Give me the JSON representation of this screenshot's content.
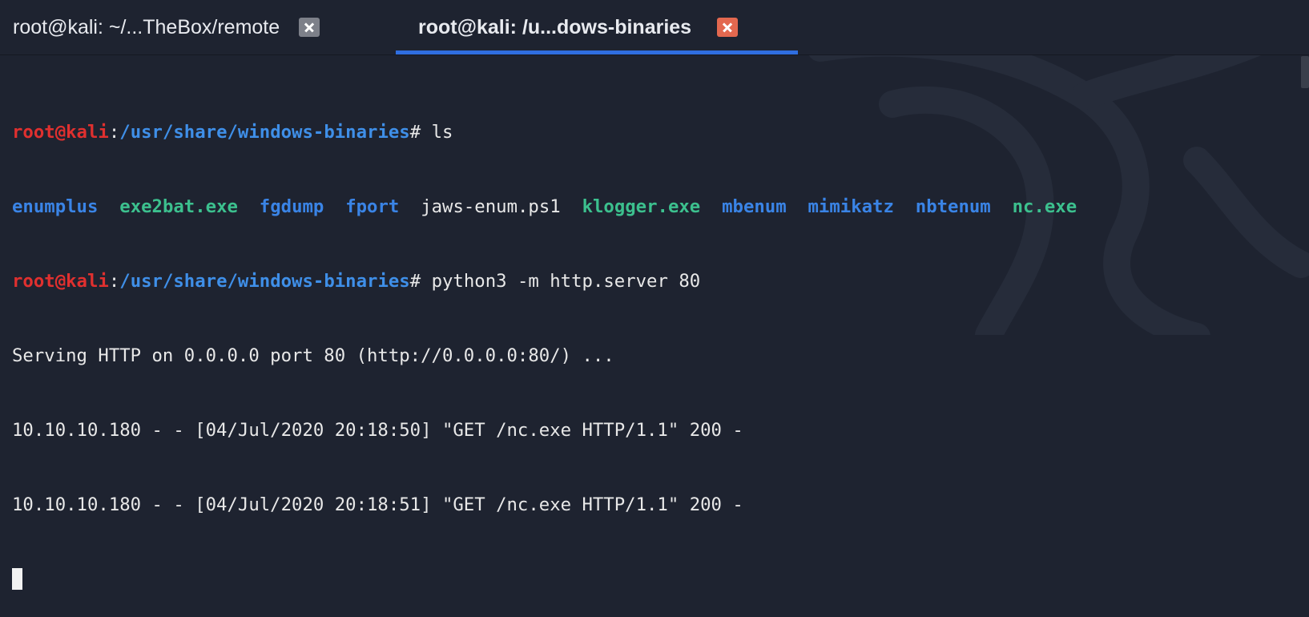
{
  "tabs": [
    {
      "label": "root@kali: ~/...TheBox/remote",
      "active": false
    },
    {
      "label": "root@kali: /u...dows-binaries",
      "active": true
    }
  ],
  "terminal": {
    "prompt_user": "root@kali",
    "prompt_colon": ":",
    "prompt_path": "/usr/share/windows-binaries",
    "prompt_hash": "#",
    "cmd1": " ls",
    "ls_entries": [
      {
        "name": "enumplus",
        "kind": "dir"
      },
      {
        "name": "exe2bat.exe",
        "kind": "exe"
      },
      {
        "name": "fgdump",
        "kind": "dir"
      },
      {
        "name": "fport",
        "kind": "dir"
      },
      {
        "name": "jaws-enum.ps1",
        "kind": "file"
      },
      {
        "name": "klogger.exe",
        "kind": "exe"
      },
      {
        "name": "mbenum",
        "kind": "dir"
      },
      {
        "name": "mimikatz",
        "kind": "dir"
      },
      {
        "name": "nbtenum",
        "kind": "dir"
      },
      {
        "name": "nc.exe",
        "kind": "exe"
      }
    ],
    "cmd2": " python3 -m http.server 80",
    "output": [
      "Serving HTTP on 0.0.0.0 port 80 (http://0.0.0.0:80/) ...",
      "10.10.10.180 - - [04/Jul/2020 20:18:50] \"GET /nc.exe HTTP/1.1\" 200 -",
      "10.10.10.180 - - [04/Jul/2020 20:18:51] \"GET /nc.exe HTTP/1.1\" 200 -"
    ]
  },
  "colors": {
    "background": "#1e2330",
    "prompt_user": "#e0302f",
    "prompt_path": "#3f8fe8",
    "directory": "#3a84e6",
    "executable": "#3cc08e",
    "tab_underline": "#2f6ee0",
    "close_active": "#e3684f"
  },
  "icons": {
    "close": "close-icon",
    "background": "kali-dragon-watermark"
  }
}
